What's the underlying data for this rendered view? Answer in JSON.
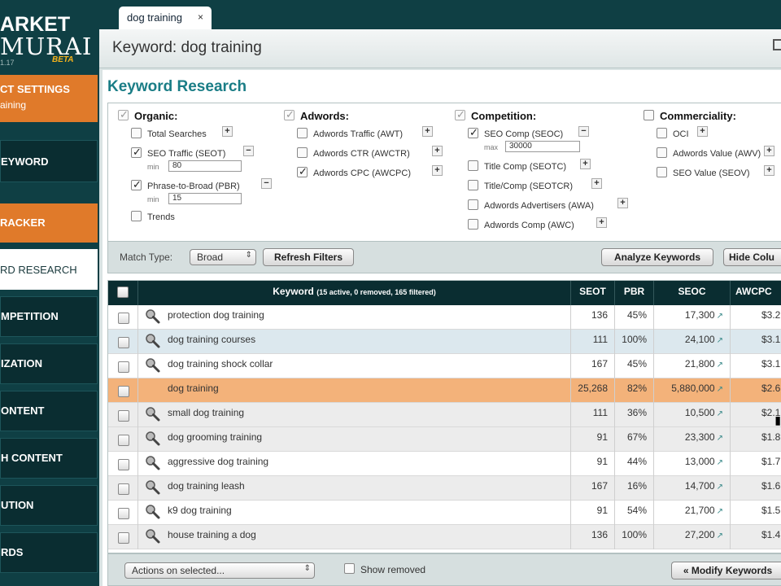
{
  "logo": {
    "line1": "ARKET",
    "line2": "MURAI",
    "version": "1.17",
    "beta": "BETA"
  },
  "sidebar": {
    "items": [
      {
        "label": "CT SETTINGS",
        "sub": "aining"
      },
      {
        "label": "EYWORD"
      },
      {
        "label": "RACKER"
      },
      {
        "label": "RD RESEARCH"
      },
      {
        "label": "MPETITION"
      },
      {
        "label": "IZATION"
      },
      {
        "label": "ONTENT"
      },
      {
        "label": "H CONTENT"
      },
      {
        "label": "UTION"
      },
      {
        "label": "RDS"
      }
    ]
  },
  "tab": {
    "label": "dog training",
    "close": "×"
  },
  "header": {
    "title": "Keyword: dog training"
  },
  "section_title": "Keyword Research",
  "filters": {
    "organic": {
      "title": "Organic:",
      "total_searches": "Total Searches",
      "seo_traffic": "SEO Traffic (SEOT)",
      "seo_traffic_min_label": "min",
      "seo_traffic_min": "80",
      "phrase_to_broad": "Phrase-to-Broad (PBR)",
      "pbr_min_label": "min",
      "pbr_min": "15",
      "trends": "Trends"
    },
    "adwords": {
      "title": "Adwords:",
      "traffic": "Adwords Traffic (AWT)",
      "ctr": "Adwords CTR (AWCTR)",
      "cpc": "Adwords CPC (AWCPC)"
    },
    "competition": {
      "title": "Competition:",
      "seo_comp": "SEO Comp (SEOC)",
      "seo_comp_max_label": "max",
      "seo_comp_max": "30000",
      "title_comp": "Title Comp (SEOTC)",
      "title_comp_ratio": "Title/Comp (SEOTCR)",
      "advertisers": "Adwords Advertisers (AWA)",
      "adwords_comp": "Adwords Comp (AWC)"
    },
    "commerciality": {
      "title": "Commerciality:",
      "oci": "OCI",
      "awv": "Adwords Value (AWV)",
      "seov": "SEO Value (SEOV)"
    }
  },
  "filter_bar": {
    "match_type_label": "Match Type:",
    "match_type_value": "Broad",
    "refresh": "Refresh Filters",
    "analyze": "Analyze Keywords",
    "hide": "Hide Colu"
  },
  "table": {
    "columns": {
      "keyword": "Keyword",
      "keyword_sub": "(15 active, 0 removed, 165 filtered)",
      "seot": "SEOT",
      "pbr": "PBR",
      "seoc": "SEOC",
      "awcpc": "AWCPC"
    },
    "rows": [
      {
        "keyword": "protection dog training",
        "seot": "136",
        "pbr": "45%",
        "seoc": "17,300",
        "awcpc": "$3.2"
      },
      {
        "keyword": "dog training courses",
        "seot": "111",
        "pbr": "100%",
        "seoc": "24,100",
        "awcpc": "$3.1"
      },
      {
        "keyword": "dog training shock collar",
        "seot": "167",
        "pbr": "45%",
        "seoc": "21,800",
        "awcpc": "$3.1"
      },
      {
        "keyword": "dog training",
        "seot": "25,268",
        "pbr": "82%",
        "seoc": "5,880,000",
        "awcpc": "$2.6"
      },
      {
        "keyword": "small dog training",
        "seot": "111",
        "pbr": "36%",
        "seoc": "10,500",
        "awcpc": "$2.1"
      },
      {
        "keyword": "dog grooming training",
        "seot": "91",
        "pbr": "67%",
        "seoc": "23,300",
        "awcpc": "$1.8"
      },
      {
        "keyword": "aggressive dog training",
        "seot": "91",
        "pbr": "44%",
        "seoc": "13,000",
        "awcpc": "$1.7"
      },
      {
        "keyword": "dog training leash",
        "seot": "167",
        "pbr": "16%",
        "seoc": "14,700",
        "awcpc": "$1.6"
      },
      {
        "keyword": "k9 dog training",
        "seot": "91",
        "pbr": "54%",
        "seoc": "21,700",
        "awcpc": "$1.5"
      },
      {
        "keyword": "house training a dog",
        "seot": "136",
        "pbr": "100%",
        "seoc": "27,200",
        "awcpc": "$1.4"
      }
    ]
  },
  "bottom_bar": {
    "actions": "Actions on selected...",
    "show_removed": "Show removed",
    "modify": "« Modify Keywords"
  },
  "colors": {
    "dark_teal": "#0a2d31",
    "orange": "#e07a2a",
    "highlight_row": "#f3b27a",
    "title_teal": "#1a7d86"
  }
}
